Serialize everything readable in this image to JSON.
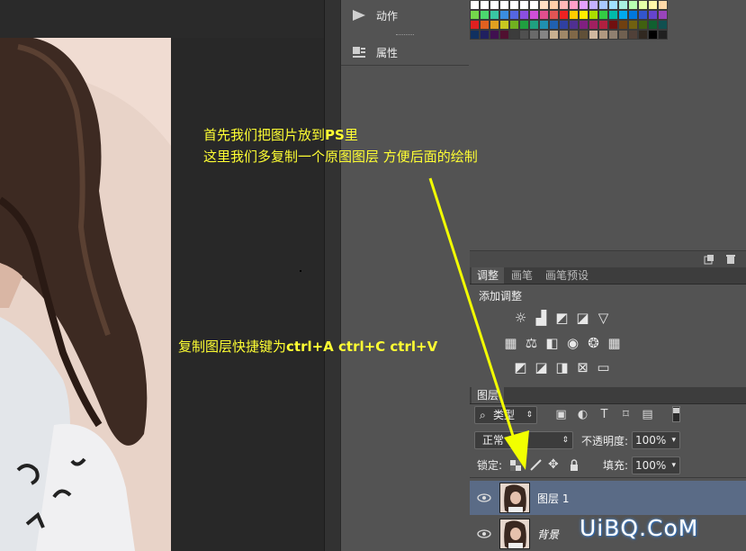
{
  "mid_panel": {
    "items": [
      {
        "label": "动作",
        "icon": "play-icon"
      },
      {
        "label": "属性",
        "icon": "properties-icon"
      }
    ]
  },
  "swatch_colors": [
    [
      "#ffffff",
      "#ffffff",
      "#ffffff",
      "#ffffff",
      "#ffffff",
      "#ffffff",
      "#ffffff",
      "#ffe0c4",
      "#ffcfa8",
      "#ffb7b7",
      "#ff9ec8",
      "#e5a0ff",
      "#c5b1ff",
      "#a8c8ff",
      "#a0e0ff",
      "#a8f0e0",
      "#b8ffb0",
      "#e5ffa8",
      "#fff7a8",
      "#ffd9a8"
    ],
    [
      "#74d84b",
      "#4bd86e",
      "#39c7a2",
      "#3a8ee0",
      "#5566e0",
      "#8b4fe0",
      "#d04fd8",
      "#e04f8e",
      "#e05555",
      "#ee2222",
      "#ffcc00",
      "#ffee00",
      "#aadd00",
      "#33cc44",
      "#00bbaa",
      "#00aaee",
      "#0077dd",
      "#3355cc",
      "#6644cc",
      "#9944bb"
    ],
    [
      "#e02020",
      "#e06020",
      "#e0a020",
      "#c8c820",
      "#70b020",
      "#20a040",
      "#20a080",
      "#2090b0",
      "#2060b0",
      "#3040a0",
      "#503090",
      "#802080",
      "#a02060",
      "#b02040",
      "#701010",
      "#704010",
      "#706010",
      "#406010",
      "#106030",
      "#105050"
    ],
    [
      "#103060",
      "#202060",
      "#401050",
      "#501030",
      "#3c3c3c",
      "#505050",
      "#6a6a6a",
      "#858585",
      "#c8b090",
      "#a08868",
      "#806848",
      "#605038",
      "#d0b8a0",
      "#b09880",
      "#908070",
      "#706050",
      "#504038",
      "#302820",
      "#000000",
      "#202020"
    ]
  ],
  "adjustments": {
    "tabs": [
      "调整",
      "画笔",
      "画笔预设"
    ],
    "title": "添加调整",
    "icon_rows": [
      [
        "brightness-icon",
        "levels-icon",
        "curves-icon",
        "exposure-icon",
        "vibrance-icon"
      ],
      [
        "hue-saturation-icon",
        "color-balance-icon",
        "black-white-icon",
        "photo-filter-icon",
        "channel-mixer-icon",
        "color-lookup-icon"
      ],
      [
        "invert-icon",
        "posterize-icon",
        "threshold-icon",
        "selective-color-icon",
        "gradient-map-icon"
      ]
    ]
  },
  "layers": {
    "tab": "图层",
    "filter_kind": "类型",
    "blend_mode": "正常",
    "opacity_label": "不透明度:",
    "opacity_value": "100%",
    "lock_label": "锁定:",
    "fill_label": "填充:",
    "fill_value": "100%",
    "items": [
      {
        "name": "图层 1",
        "selected": true
      },
      {
        "name": "背景",
        "selected": false
      }
    ]
  },
  "annotations": {
    "line1_pre": "首先我们把图片放到",
    "line1_bold": "PS",
    "line1_post": "里",
    "line2": "这里我们多复制一个原图图层 方便后面的绘制",
    "shortcut_pre": "复制图层快捷键为",
    "shortcut_bold": "ctrl+A ctrl+C ctrl+V"
  },
  "watermark": "UiBQ.CoM",
  "colors": {
    "panel": "#535353",
    "canvas": "#282828",
    "selected_row": "#5a6b86",
    "annotation": "#ffff33"
  }
}
